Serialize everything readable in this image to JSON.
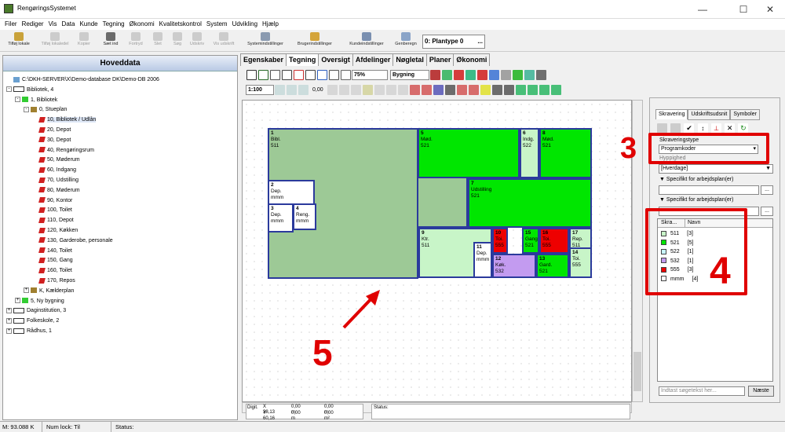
{
  "window": {
    "title": "RengøringsSystemet",
    "minimize": "—",
    "maximize": "☐",
    "close": "✕"
  },
  "menu": [
    "Filer",
    "Rediger",
    "Vis",
    "Data",
    "Kunde",
    "Tegning",
    "Økonomi",
    "Kvalitetskontrol",
    "System",
    "Udvikling",
    "Hjælp"
  ],
  "toolbar": {
    "buttons": [
      {
        "label": "Tilføj lokale",
        "enabled": true,
        "icon": "add-room-icon"
      },
      {
        "label": "Tilføj lokaledel",
        "enabled": false,
        "icon": "add-roompart-icon"
      },
      {
        "label": "Kopier",
        "enabled": false,
        "icon": "copy-icon"
      },
      {
        "label": "Sæt ind",
        "enabled": true,
        "icon": "paste-icon"
      },
      {
        "label": "Fortryd",
        "enabled": false,
        "icon": "undo-icon"
      },
      {
        "label": "Slet",
        "enabled": false,
        "icon": "delete-icon"
      },
      {
        "label": "Søg",
        "enabled": false,
        "icon": "search-icon"
      },
      {
        "label": "Udskriv",
        "enabled": false,
        "icon": "print-icon"
      },
      {
        "label": "Vis udskrift",
        "enabled": false,
        "icon": "print-preview-icon"
      },
      {
        "label": "Systemindstillinger",
        "enabled": true,
        "icon": "system-settings-icon"
      },
      {
        "label": "Brugerindstillinger",
        "enabled": true,
        "icon": "user-settings-icon"
      },
      {
        "label": "Kundeindstillinger",
        "enabled": true,
        "icon": "customer-settings-icon"
      },
      {
        "label": "Genberegn",
        "enabled": true,
        "icon": "recalculate-icon"
      }
    ],
    "plantype": "0: Plantype 0",
    "plantype_btn": "..."
  },
  "left_panel": {
    "title": "Hoveddata",
    "tree": [
      {
        "label": "C:\\DKH-SERVER\\X\\Demo-database DK\\Demo-DB 2006",
        "level": 0,
        "expander": "",
        "icon": "database"
      },
      {
        "label": "Bibliotek, 4",
        "level": 0,
        "expander": "-",
        "icon": "building"
      },
      {
        "label": "1, Bibliotek",
        "level": 1,
        "expander": "-",
        "icon": "green"
      },
      {
        "label": "0, Stueplan",
        "level": 2,
        "expander": "-",
        "icon": "floor"
      },
      {
        "label": "10, Bibliotek / Udlån",
        "level": 3,
        "expander": "",
        "icon": "room",
        "selected": true
      },
      {
        "label": "20, Depot",
        "level": 3,
        "expander": "",
        "icon": "room"
      },
      {
        "label": "30, Depot",
        "level": 3,
        "expander": "",
        "icon": "room"
      },
      {
        "label": "40, Rengøringsrum",
        "level": 3,
        "expander": "",
        "icon": "room"
      },
      {
        "label": "50, Møderum",
        "level": 3,
        "expander": "",
        "icon": "room"
      },
      {
        "label": "60, Indgang",
        "level": 3,
        "expander": "",
        "icon": "room"
      },
      {
        "label": "70, Udstilling",
        "level": 3,
        "expander": "",
        "icon": "room"
      },
      {
        "label": "80, Møderum",
        "level": 3,
        "expander": "",
        "icon": "room"
      },
      {
        "label": "90, Kontor",
        "level": 3,
        "expander": "",
        "icon": "room"
      },
      {
        "label": "100, Toilet",
        "level": 3,
        "expander": "",
        "icon": "room"
      },
      {
        "label": "110, Depot",
        "level": 3,
        "expander": "",
        "icon": "room"
      },
      {
        "label": "120, Køkken",
        "level": 3,
        "expander": "",
        "icon": "room"
      },
      {
        "label": "130, Garderobe, personale",
        "level": 3,
        "expander": "",
        "icon": "room"
      },
      {
        "label": "140, Toilet",
        "level": 3,
        "expander": "",
        "icon": "room"
      },
      {
        "label": "150, Gang",
        "level": 3,
        "expander": "",
        "icon": "room"
      },
      {
        "label": "160, Toilet",
        "level": 3,
        "expander": "",
        "icon": "room"
      },
      {
        "label": "170, Repos",
        "level": 3,
        "expander": "",
        "icon": "room"
      },
      {
        "label": "K, Kælderplan",
        "level": 2,
        "expander": "+",
        "icon": "floor"
      },
      {
        "label": "5, Ny bygning",
        "level": 1,
        "expander": "+",
        "icon": "green"
      },
      {
        "label": "Daginstitution, 3",
        "level": 0,
        "expander": "+",
        "icon": "building"
      },
      {
        "label": "Folkeskole, 2",
        "level": 0,
        "expander": "+",
        "icon": "building"
      },
      {
        "label": "Rådhus, 1",
        "level": 0,
        "expander": "+",
        "icon": "building"
      }
    ]
  },
  "tabs": [
    "Egenskaber",
    "Tegning",
    "Oversigt",
    "Afdelinger",
    "Nøgletal",
    "Planer",
    "Økonomi"
  ],
  "active_tab": "Tegning",
  "drawing_toolbar": {
    "zoom": "75%",
    "layer": "Bygning",
    "scale": "1:100",
    "line_width": "0,00"
  },
  "plan": {
    "rooms": [
      {
        "num": "1",
        "name": "Bibl.",
        "code": "511",
        "color": "#9dc996"
      },
      {
        "num": "5",
        "name": "Mød.",
        "code": "521",
        "color": "#00e600"
      },
      {
        "num": "6",
        "name": "Indg.",
        "code": "522",
        "color": "#c8f5c8"
      },
      {
        "num": "8",
        "name": "Mød.",
        "code": "521",
        "color": "#00e600"
      },
      {
        "num": "7",
        "name": "Udstilling",
        "code": "521",
        "color": "#00e600"
      },
      {
        "num": "2",
        "name": "Dep.",
        "code": "mmm",
        "color": "#ffffff"
      },
      {
        "num": "3",
        "name": "Dep.",
        "code": "mmm",
        "color": "#ffffff"
      },
      {
        "num": "4",
        "name": "Reng.",
        "code": "mmm",
        "color": "#ffffff"
      },
      {
        "num": "9",
        "name": "Ktr.",
        "code": "511",
        "color": "#c8f5c8"
      },
      {
        "num": "10",
        "name": "Toi.",
        "code": "555",
        "color": "#ee0000"
      },
      {
        "num": "15",
        "name": "Gang",
        "code": "521",
        "color": "#00e600"
      },
      {
        "num": "16",
        "name": "Toi.",
        "code": "555",
        "color": "#ee0000"
      },
      {
        "num": "17",
        "name": "Rep.",
        "code": "511",
        "color": "#c8f5c8"
      },
      {
        "num": "11",
        "name": "Dep.",
        "code": "mmm",
        "color": "#ffffff"
      },
      {
        "num": "12",
        "name": "Køk.",
        "code": "532",
        "color": "#c39bf0"
      },
      {
        "num": "13",
        "name": "Gard.",
        "code": "521",
        "color": "#00e600"
      },
      {
        "num": "14",
        "name": "Toi.",
        "code": "555",
        "color": "#c8f5c8"
      }
    ]
  },
  "right_panel": {
    "tabs": [
      "Skravering",
      "Udskriftsudsnit",
      "Symboler"
    ],
    "active_tab": "Skravering",
    "skraveringstype_label": "Skraveringstype",
    "skraveringstype_value": "Programkoder",
    "hidden_label": "Hyppighed",
    "hverdage": "[Hverdage]",
    "spec1": "Specifikt for arbejdsplan(er)",
    "spec2": "Specifikt for arbejdsplan(er)",
    "ellipsis": "...",
    "legend_headers": [
      "Skra...",
      "Navn"
    ],
    "legend": [
      {
        "code": "511",
        "count": "[3]",
        "color": "#c8f5c8"
      },
      {
        "code": "521",
        "count": "[5]",
        "color": "#00e600"
      },
      {
        "code": "522",
        "count": "[1]",
        "color": "#c8f5ff"
      },
      {
        "code": "532",
        "count": "[1]",
        "color": "#c39bf0"
      },
      {
        "code": "555",
        "count": "[3]",
        "color": "#ee0000"
      },
      {
        "code": "mmm",
        "count": "[4]",
        "color": "#ffffff"
      }
    ],
    "search_placeholder": "Indtast søgetekst her...",
    "next_button": "Næste"
  },
  "annotations": {
    "n3": "3",
    "n4": "4",
    "n5": "5"
  },
  "coords": {
    "digit": "Digit.",
    "x": "X 38,13",
    "y": "Y 60,16",
    "dx": "0,00 m",
    "dy": "0,00 m",
    "len": "0,00 m",
    "area": "0,00 m²",
    "status": "Status:"
  },
  "statusbar": {
    "memory": "M: 93.088 K",
    "numlock": "Num lock: Til",
    "status": "Status:"
  },
  "colors": {
    "accent": "#e00000",
    "wall": "#2b3a9c"
  }
}
